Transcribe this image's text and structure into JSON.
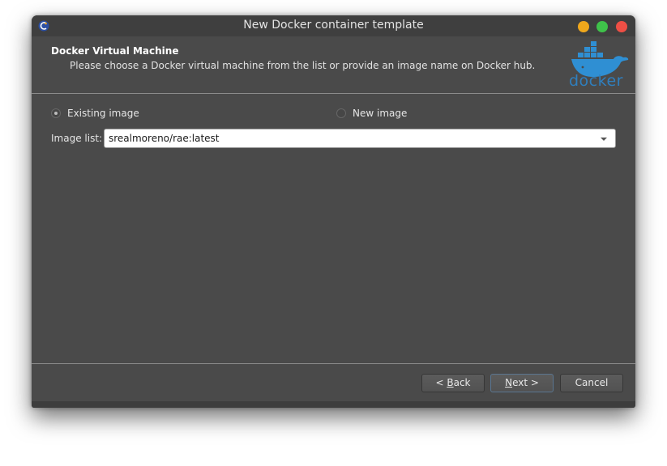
{
  "window": {
    "title": "New Docker container template",
    "controls": [
      "minimize",
      "maximize",
      "close"
    ]
  },
  "header": {
    "title": "Docker Virtual Machine",
    "description": "Please choose a Docker virtual machine from the list or provide an image name on Docker hub.",
    "logo_text": "docker"
  },
  "options": {
    "existing_image": "Existing image",
    "new_image": "New image",
    "selected": "existing_image"
  },
  "image_list": {
    "label": "Image list:",
    "value": "srealmoreno/rae:latest"
  },
  "buttons": {
    "back_prefix": "< ",
    "back_mnemonic": "B",
    "back_rest": "ack",
    "next_mnemonic": "N",
    "next_rest": "ext >",
    "cancel": "Cancel"
  },
  "colors": {
    "window_bg": "#4a4a4a",
    "titlebar_bg": "#3f3f3f",
    "minimize": "#f0a81c",
    "maximize": "#3fc24a",
    "close": "#ee4f45",
    "docker_blue": "#2f7fbe"
  }
}
